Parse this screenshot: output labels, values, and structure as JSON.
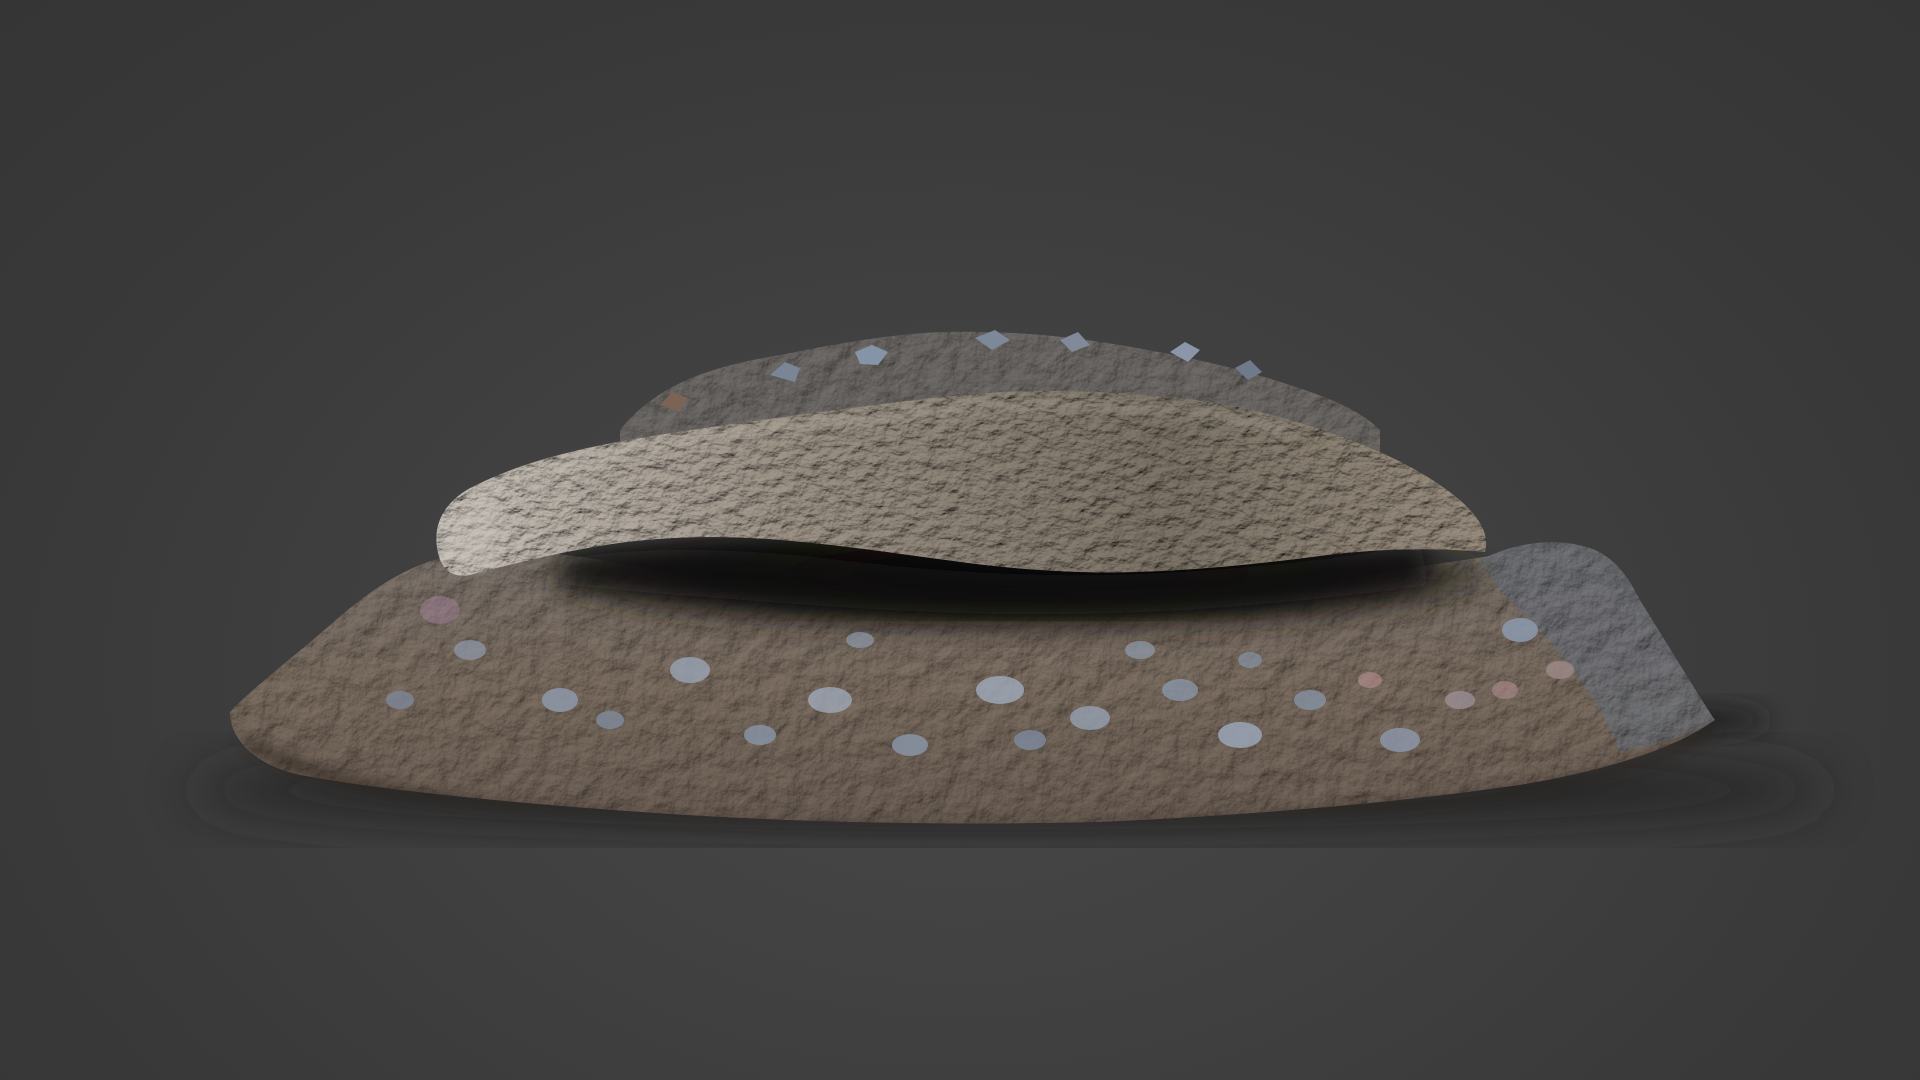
{
  "scene": {
    "subject": "rock-outcrop-scan",
    "background_color": "#3c3c3c",
    "palette": {
      "soil": "#5a4a3c",
      "slab": "#6e6558",
      "slab_highlight": "#b9b3aa",
      "pebble": "#8fa0b8",
      "shadow": "#0f0d0c"
    }
  }
}
